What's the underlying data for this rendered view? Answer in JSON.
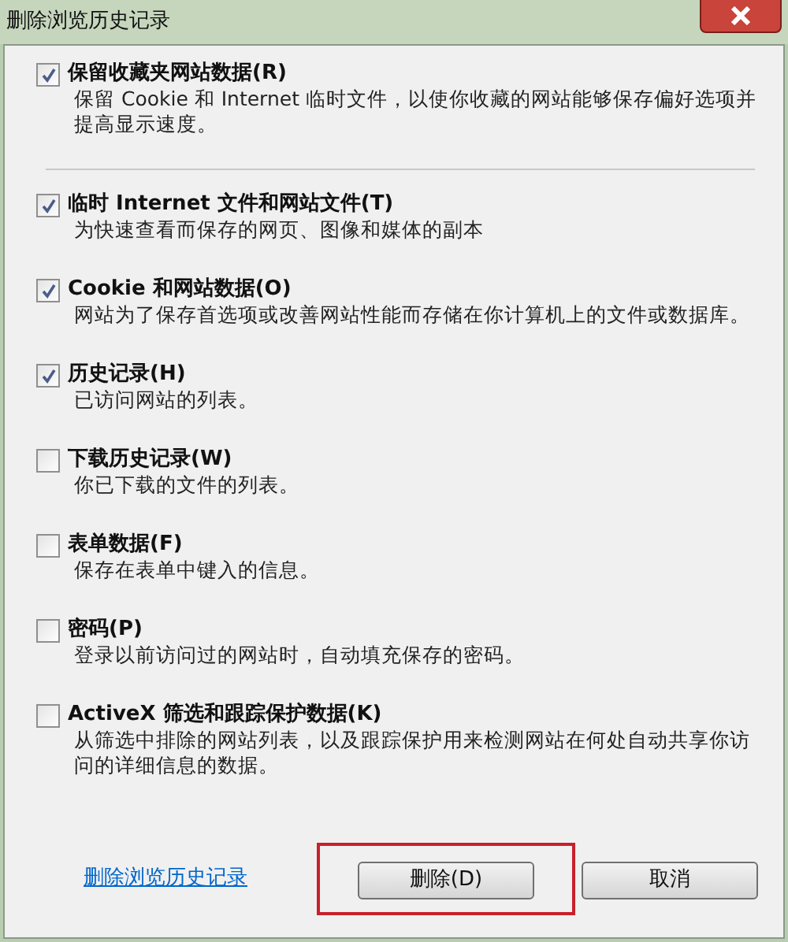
{
  "window": {
    "title": "删除浏览历史记录"
  },
  "options": [
    {
      "label": "保留收藏夹网站数据(R)",
      "description": "保留 Cookie 和 Internet 临时文件，以使你收藏的网站能够保存偏好选项并提高显示速度。",
      "checked": true
    },
    {
      "label": "临时 Internet 文件和网站文件(T)",
      "description": "为快速查看而保存的网页、图像和媒体的副本",
      "checked": true
    },
    {
      "label": "Cookie 和网站数据(O)",
      "description": "网站为了保存首选项或改善网站性能而存储在你计算机上的文件或数据库。",
      "checked": true
    },
    {
      "label": "历史记录(H)",
      "description": "已访问网站的列表。",
      "checked": true
    },
    {
      "label": "下载历史记录(W)",
      "description": "你已下载的文件的列表。",
      "checked": false
    },
    {
      "label": "表单数据(F)",
      "description": "保存在表单中键入的信息。",
      "checked": false
    },
    {
      "label": "密码(P)",
      "description": "登录以前访问过的网站时，自动填充保存的密码。",
      "checked": false
    },
    {
      "label": "ActiveX 筛选和跟踪保护数据(K)",
      "description": "从筛选中排除的网站列表，以及跟踪保护用来检测网站在何处自动共享你访问的详细信息的数据。",
      "checked": false
    }
  ],
  "footer": {
    "link": "删除浏览历史记录",
    "buttons": [
      {
        "label": "删除(D)",
        "highlighted": true
      },
      {
        "label": "取消",
        "highlighted": false
      }
    ]
  }
}
